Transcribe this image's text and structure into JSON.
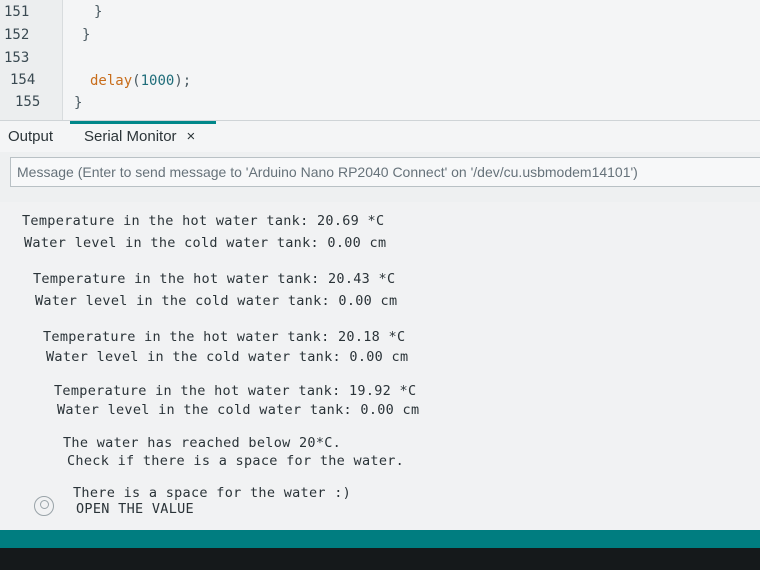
{
  "editor": {
    "line_numbers": [
      "151",
      "152",
      "153",
      "154",
      "155"
    ],
    "brace_1": "}",
    "brace_2": "}",
    "delay_fn": "delay",
    "delay_arg": "1000",
    "delay_open": "(",
    "delay_close": ");",
    "brace_3": "}"
  },
  "tabs": {
    "output_label": "Output",
    "serial_label": "Serial Monitor",
    "close_glyph": "×"
  },
  "message": {
    "placeholder": "Message (Enter to send message to 'Arduino Nano RP2040 Connect' on '/dev/cu.usbmodem14101')"
  },
  "serial_lines": [
    "Temperature in the hot water tank: 20.69 *C",
    "Water level in the cold water tank: 0.00 cm",
    "Temperature in the hot water tank: 20.43 *C",
    "Water level in the cold water tank: 0.00 cm",
    "Temperature in the hot water tank: 20.18 *C",
    "Water level in the cold water tank: 0.00 cm",
    "Temperature in the hot water tank: 19.92 *C",
    "Water level in the cold water tank: 0.00 cm",
    "The water has reached below 20*C.",
    "Check if there is a space for the water.",
    "There is a space for the water :)",
    "OPEN THE VALUE"
  ],
  "icons": {
    "avatar": "user-circle-icon",
    "close": "close-icon"
  },
  "colors": {
    "accent": "#00878a",
    "status_bar": "#007d80"
  }
}
